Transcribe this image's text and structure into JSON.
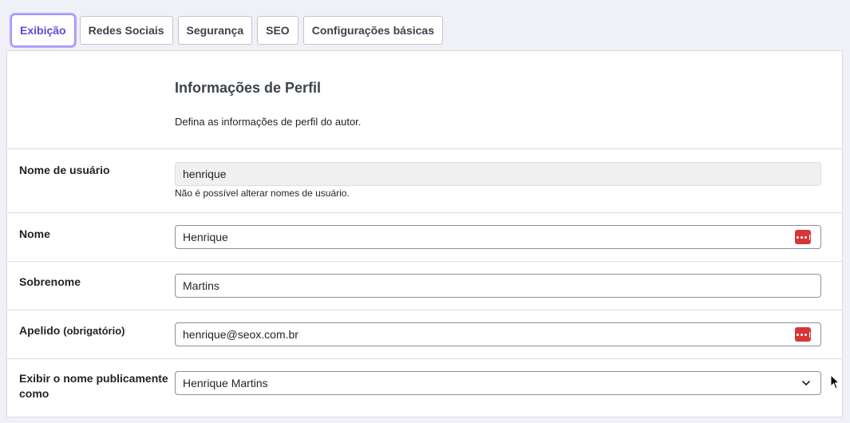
{
  "tabs": [
    {
      "label": "Exibição",
      "active": true
    },
    {
      "label": "Redes Sociais"
    },
    {
      "label": "Segurança"
    },
    {
      "label": "SEO"
    },
    {
      "label": "Configurações básicas"
    }
  ],
  "section": {
    "title": "Informações de Perfil",
    "description": "Defina as informações de perfil do autor."
  },
  "fields": {
    "username": {
      "label": "Nome de usuário",
      "value": "henrique",
      "hint": "Não é possível alterar nomes de usuário."
    },
    "first_name": {
      "label": "Nome",
      "value": "Henrique"
    },
    "last_name": {
      "label": "Sobrenome",
      "value": "Martins"
    },
    "nickname": {
      "label": "Apelido",
      "label_note": "(obrigatório)",
      "value": "henrique@seox.com.br"
    },
    "display_name": {
      "label": "Exibir o nome publicamente como",
      "value": "Henrique Martins"
    }
  },
  "icons": {
    "password_manager": "password-manager-icon",
    "select_arrow": "chevron-down-icon",
    "cursor": "mouse-pointer-icon"
  },
  "colors": {
    "accent": "#5b4bd6",
    "password_icon": "#d63638"
  }
}
